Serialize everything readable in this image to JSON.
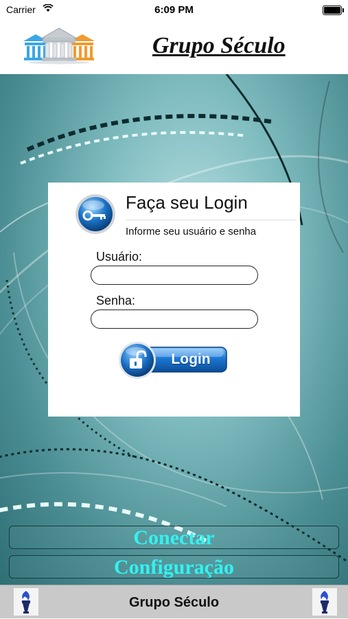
{
  "status_bar": {
    "carrier": "Carrier",
    "time": "6:09 PM"
  },
  "header": {
    "title": "Grupo Século",
    "logo_icon": "building-columns-icon"
  },
  "login_card": {
    "heading": "Faça seu Login",
    "subheading": "Informe seu usuário e senha",
    "user_label": "Usuário:",
    "user_value": "",
    "password_label": "Senha:",
    "password_value": "",
    "login_button_label": "Login",
    "key_icon": "key-icon",
    "lock_icon": "unlock-icon"
  },
  "actions": {
    "connect_label": "Conectar",
    "settings_label": "Configuração"
  },
  "footer": {
    "title": "Grupo Século",
    "icon": "torch-icon"
  },
  "colors": {
    "accent_cyan": "#33f2f2",
    "background_teal": "#5fa3a8",
    "login_blue": "#1a6fc4"
  }
}
